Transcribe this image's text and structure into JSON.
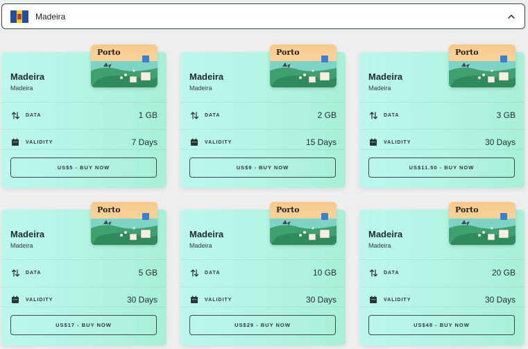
{
  "selector": {
    "label": "Madeira",
    "flag_colors": [
      "#1f4ea3",
      "#f5cc1a",
      "#1f4ea3"
    ]
  },
  "colors": {
    "card_bg_start": "#bdf7ec",
    "card_bg_end": "#a9f0d8",
    "border": "#3a4a4a"
  },
  "cards": [
    {
      "title": "Madeira",
      "subtitle": "Madeira",
      "image_label": "Porto",
      "data_label": "DATA",
      "data_value": "1 GB",
      "validity_label": "VALIDITY",
      "validity_value": "7 Days",
      "buy_label": "US$5 - BUY NOW"
    },
    {
      "title": "Madeira",
      "subtitle": "Madeira",
      "image_label": "Porto",
      "data_label": "DATA",
      "data_value": "2 GB",
      "validity_label": "VALIDITY",
      "validity_value": "15 Days",
      "buy_label": "US$9 - BUY NOW"
    },
    {
      "title": "Madeira",
      "subtitle": "Madeira",
      "image_label": "Porto",
      "data_label": "DATA",
      "data_value": "3 GB",
      "validity_label": "VALIDITY",
      "validity_value": "30 Days",
      "buy_label": "US$11.50 - BUY NOW"
    },
    {
      "title": "Madeira",
      "subtitle": "Madeira",
      "image_label": "Porto",
      "data_label": "DATA",
      "data_value": "5 GB",
      "validity_label": "VALIDITY",
      "validity_value": "30 Days",
      "buy_label": "US$17 - BUY NOW"
    },
    {
      "title": "Madeira",
      "subtitle": "Madeira",
      "image_label": "Porto",
      "data_label": "DATA",
      "data_value": "10 GB",
      "validity_label": "VALIDITY",
      "validity_value": "30 Days",
      "buy_label": "US$29 - BUY NOW"
    },
    {
      "title": "Madeira",
      "subtitle": "Madeira",
      "image_label": "Porto",
      "data_label": "DATA",
      "data_value": "20 GB",
      "validity_label": "VALIDITY",
      "validity_value": "30 Days",
      "buy_label": "US$48 - BUY NOW"
    }
  ],
  "icons": {
    "data": "swap-vertical-icon",
    "validity": "calendar-icon",
    "selector_toggle": "chevron-up-icon"
  }
}
